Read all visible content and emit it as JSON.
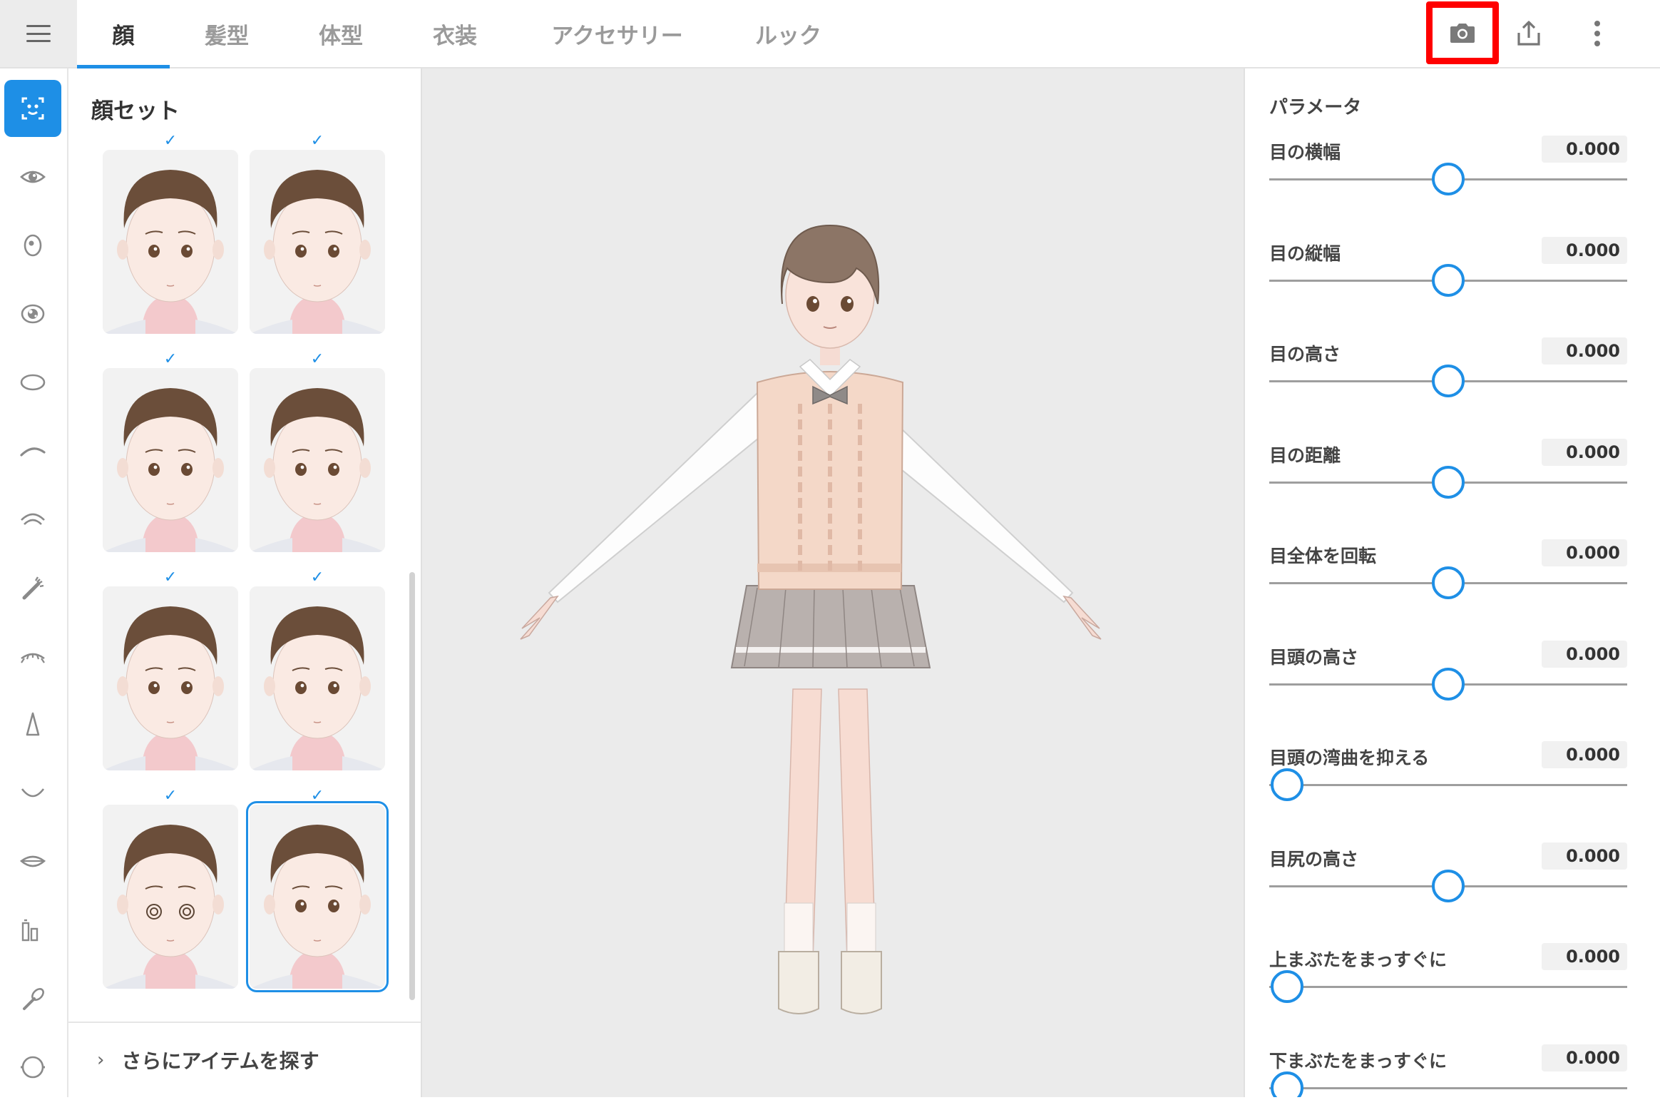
{
  "tabs": [
    {
      "label": "顔",
      "active": true
    },
    {
      "label": "髪型",
      "active": false
    },
    {
      "label": "体型",
      "active": false
    },
    {
      "label": "衣装",
      "active": false
    },
    {
      "label": "アクセサリー",
      "active": false
    },
    {
      "label": "ルック",
      "active": false
    }
  ],
  "toolbar": {
    "menu_icon": "hamburger-menu-icon",
    "camera_icon": "camera-icon",
    "share_icon": "share-export-icon",
    "more_icon": "more-vertical-icon",
    "camera_highlight_color": "#ff0000"
  },
  "rail": {
    "items": [
      {
        "icon": "face-set-icon",
        "active": true
      },
      {
        "icon": "eye-icon",
        "active": false
      },
      {
        "icon": "iris-icon",
        "active": false
      },
      {
        "icon": "eye-highlight-icon",
        "active": false
      },
      {
        "icon": "face-outline-icon",
        "active": false
      },
      {
        "icon": "eyebrow-icon",
        "active": false
      },
      {
        "icon": "eyelid-icon",
        "active": false
      },
      {
        "icon": "eyelash-icon",
        "active": false
      },
      {
        "icon": "lower-eyelash-icon",
        "active": false
      },
      {
        "icon": "nose-icon",
        "active": false
      },
      {
        "icon": "mouth-icon",
        "active": false
      },
      {
        "icon": "lips-icon",
        "active": false
      },
      {
        "icon": "teeth-icon",
        "active": false
      },
      {
        "icon": "makeup-brush-icon",
        "active": false
      },
      {
        "icon": "ear-icon",
        "active": false
      }
    ]
  },
  "faceset": {
    "title": "顔セット",
    "more_label": "さらにアイテムを探す",
    "items": [
      {
        "variant": "normal",
        "checked": true,
        "selected": false
      },
      {
        "variant": "normal-lashes",
        "checked": true,
        "selected": false
      },
      {
        "variant": "soft",
        "checked": true,
        "selected": false
      },
      {
        "variant": "sharp",
        "checked": true,
        "selected": false
      },
      {
        "variant": "round",
        "checked": true,
        "selected": false
      },
      {
        "variant": "narrow",
        "checked": true,
        "selected": false
      },
      {
        "variant": "dizzy",
        "checked": true,
        "selected": false
      },
      {
        "variant": "default",
        "checked": true,
        "selected": true
      }
    ],
    "check_glyph": "✓"
  },
  "params": {
    "title": "パラメータ",
    "items": [
      {
        "label": "目の横幅",
        "value": "0.000",
        "position": 0.5
      },
      {
        "label": "目の縦幅",
        "value": "0.000",
        "position": 0.5
      },
      {
        "label": "目の高さ",
        "value": "0.000",
        "position": 0.5
      },
      {
        "label": "目の距離",
        "value": "0.000",
        "position": 0.5
      },
      {
        "label": "目全体を回転",
        "value": "0.000",
        "position": 0.5
      },
      {
        "label": "目頭の高さ",
        "value": "0.000",
        "position": 0.5
      },
      {
        "label": "目頭の湾曲を抑える",
        "value": "0.000",
        "position": 0.05
      },
      {
        "label": "目尻の高さ",
        "value": "0.000",
        "position": 0.5
      },
      {
        "label": "上まぶたをまっすぐに",
        "value": "0.000",
        "position": 0.05
      },
      {
        "label": "下まぶたをまっすぐに",
        "value": "0.000",
        "position": 0.05
      }
    ]
  },
  "colors": {
    "accent": "#1e8fe6",
    "viewport_bg": "#ebebeb"
  }
}
